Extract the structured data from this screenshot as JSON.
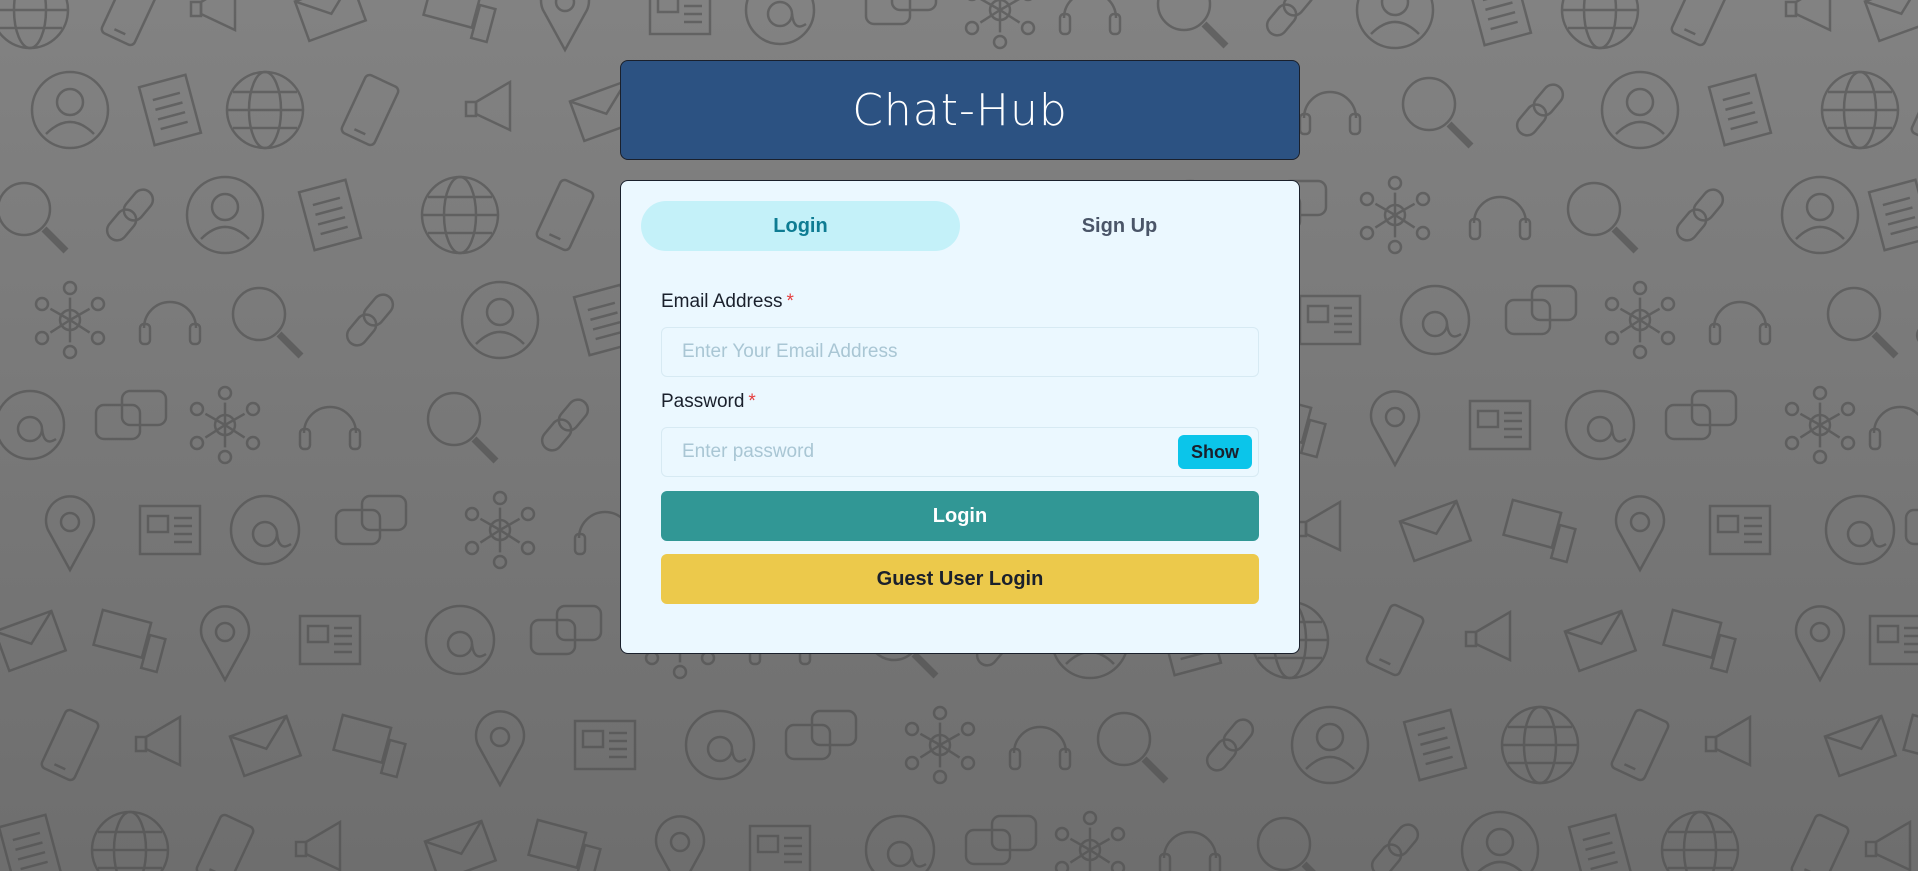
{
  "app": {
    "title": "Chat-Hub"
  },
  "tabs": [
    {
      "label": "Login",
      "active": true
    },
    {
      "label": "Sign Up",
      "active": false
    }
  ],
  "form": {
    "email": {
      "label": "Email Address",
      "required_mark": "*",
      "placeholder": "Enter Your Email Address",
      "value": ""
    },
    "password": {
      "label": "Password",
      "required_mark": "*",
      "placeholder": "Enter password",
      "value": "",
      "toggle_label": "Show"
    },
    "login_button": "Login",
    "guest_button": "Guest User Login"
  },
  "colors": {
    "header_bg": "#2c5282",
    "card_bg": "#ebf8ff",
    "active_tab_bg": "#c4f1f9",
    "login_button": "#319795",
    "guest_button": "#ecc94b",
    "show_button": "#0bc5ea",
    "required": "#e53e3e"
  },
  "background_icons": [
    "document-icon",
    "link-icon",
    "network-icon",
    "globe-icon",
    "user-icon",
    "search-icon",
    "envelope-icon",
    "phone-icon",
    "location-pin-icon",
    "megaphone-icon",
    "at-sign-icon",
    "newspaper-icon",
    "headset-icon",
    "chat-bubbles-icon",
    "computer-icon"
  ]
}
